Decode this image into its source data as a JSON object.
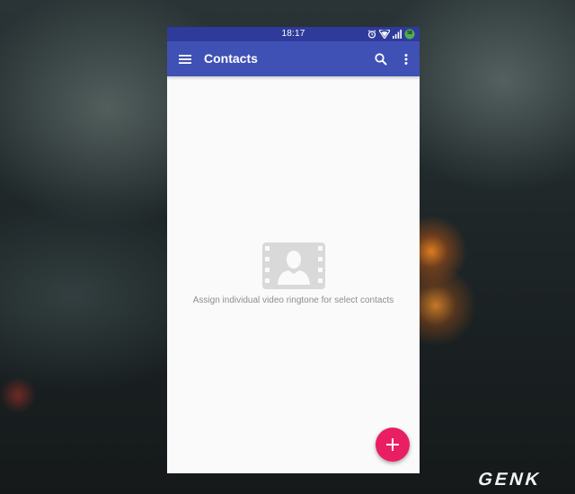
{
  "status_bar": {
    "time": "18:17",
    "icons": [
      "alarm-icon",
      "wifi-icon",
      "signal-icon",
      "battery-icon"
    ],
    "battery_label": "58"
  },
  "app_bar": {
    "title": "Contacts",
    "icons": [
      "menu-icon",
      "search-icon",
      "more-vert-icon"
    ],
    "color": "#3f51b5",
    "status_color": "#2f3b9b"
  },
  "empty_state": {
    "icon": "contact-video-icon",
    "message": "Assign individual video ringtone for select contacts"
  },
  "fab": {
    "icon": "add-icon",
    "color": "#e91e63"
  },
  "watermark": {
    "text": "GENK"
  }
}
